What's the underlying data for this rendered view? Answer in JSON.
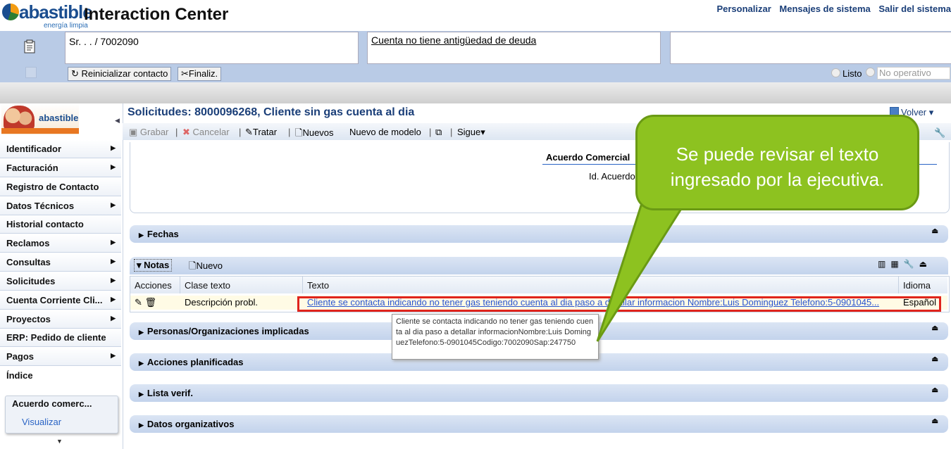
{
  "header": {
    "brand": "abastible",
    "brand_sub": "energía limpia",
    "title": "Interaction Center",
    "links": [
      "Personalizar",
      "Mensajes de sistema",
      "Salir del sistema"
    ]
  },
  "context": {
    "customer": "Sr. . . / 7002090",
    "debt_status": "Cuenta no tiene antigüedad de deuda",
    "btn_reset": "Reinicializar contacto",
    "btn_finish": "Finaliz.",
    "status_ready": "Listo",
    "status_not_operative": "No operativo"
  },
  "sidebar": {
    "logo_text": "abastible",
    "items": [
      {
        "label": "Identificador",
        "arrow": true
      },
      {
        "label": "Facturación",
        "arrow": true
      },
      {
        "label": "Registro de Contacto",
        "arrow": false
      },
      {
        "label": "Datos Técnicos",
        "arrow": true
      },
      {
        "label": "Historial contacto",
        "arrow": false
      },
      {
        "label": "Reclamos",
        "arrow": true
      },
      {
        "label": "Consultas",
        "arrow": true
      },
      {
        "label": "Solicitudes",
        "arrow": true
      },
      {
        "label": "Cuenta Corriente Cli...",
        "arrow": true
      },
      {
        "label": "Proyectos",
        "arrow": true
      },
      {
        "label": "ERP: Pedido de cliente",
        "arrow": false
      },
      {
        "label": "Pagos",
        "arrow": true
      },
      {
        "label": "Índice",
        "arrow": false
      }
    ],
    "recent_title": "Acuerdo comerc...",
    "recent_link": "Visualizar"
  },
  "main": {
    "title": "Solicitudes: 8000096268, Cliente sin gas cuenta al dia",
    "back": "Volver",
    "toolbar": {
      "save": "Grabar",
      "cancel": "Cancelar",
      "process": "Tratar",
      "new": "Nuevos",
      "new_model": "Nuevo de modelo",
      "next": "Sigue"
    },
    "acuerdo_label": "Acuerdo Comercial",
    "id_acuerdo_label": "Id. Acuerdo",
    "sections": [
      "Fechas",
      "Personas/Organizaciones implicadas",
      "Acciones planificadas",
      "Lista verif.",
      "Datos organizativos"
    ],
    "notes": {
      "toggle": "Notas",
      "new": "Nuevo",
      "columns": [
        "Acciones",
        "Clase texto",
        "Texto",
        "Idioma"
      ],
      "row": {
        "clase": "Descripción probl.",
        "texto": "Cliente se contacta indicando no tener gas teniendo cuenta al dia paso a detallar informacion Nombre:Luis Dominguez Telefono:5-0901045...",
        "idioma": "Español"
      }
    },
    "tooltip": "Cliente se contacta indicando no tener gas teniendo cuenta al dia paso a detallar informacionNombre:Luis DominguezTelefono:5-0901045Codigo:7002090Sap:247750"
  },
  "callout": "Se puede revisar el texto ingresado por la ejecutiva."
}
